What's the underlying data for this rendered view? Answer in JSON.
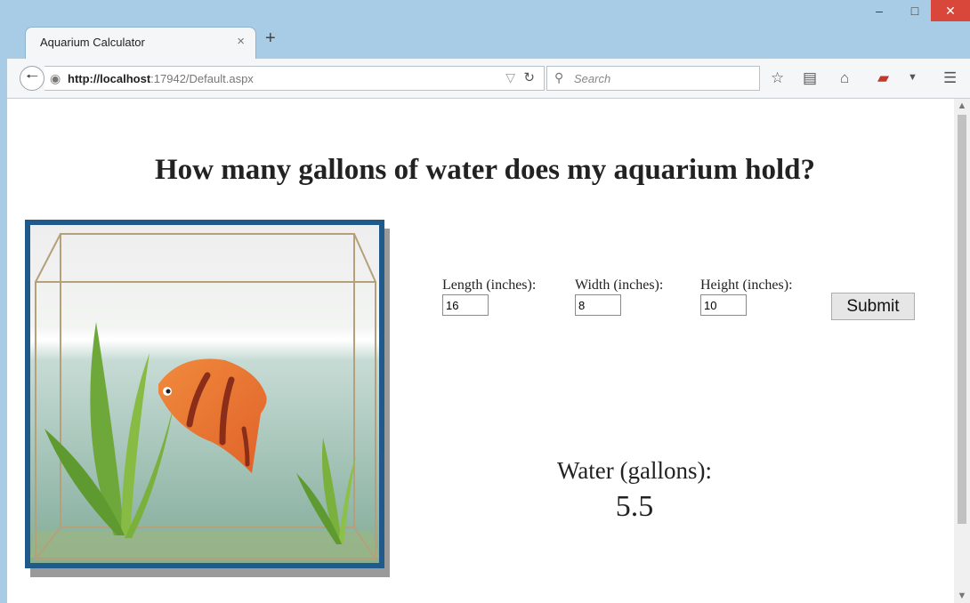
{
  "browser": {
    "tab_title": "Aquarium Calculator",
    "tab_close": "×",
    "new_tab": "+",
    "url_host": "http://localhost",
    "url_rest": ":17942/Default.aspx",
    "search_placeholder": "Search"
  },
  "icons": [
    "minimize-icon",
    "maximize-icon",
    "close-icon",
    "back-arrow-icon",
    "globe-icon",
    "dropdown-icon",
    "reload-icon",
    "search-icon",
    "star-icon",
    "reading-list-icon",
    "home-icon",
    "pdf-icon",
    "menu-icon"
  ],
  "page": {
    "heading": "How many gallons of water does my aquarium hold?",
    "fields": {
      "length": {
        "label": "Length (inches):",
        "value": "16"
      },
      "width": {
        "label": "Width (inches):",
        "value": "8"
      },
      "height": {
        "label": "Height (inches):",
        "value": "10"
      }
    },
    "submit_label": "Submit",
    "result_label": "Water (gallons):",
    "result_value": "5.5"
  }
}
